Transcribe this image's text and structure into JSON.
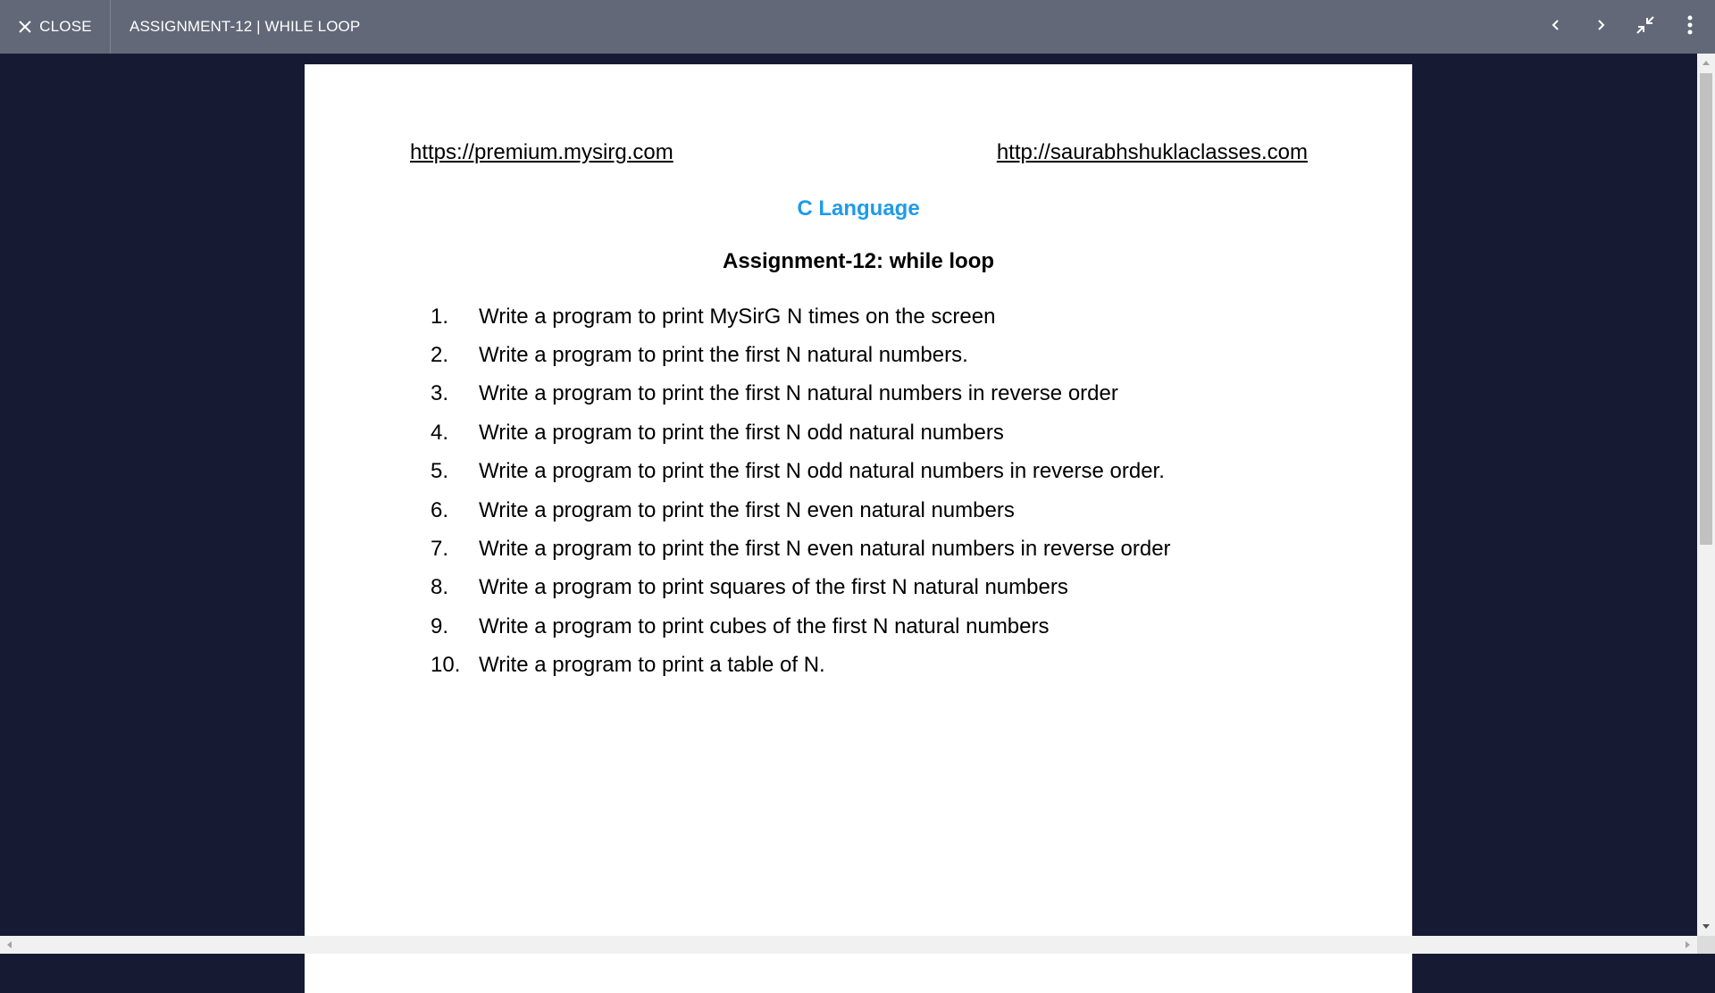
{
  "topbar": {
    "close_label": "CLOSE",
    "title": "ASSIGNMENT-12 | WHILE LOOP",
    "background": "#636878"
  },
  "icons": {
    "close": "close-icon",
    "prev": "chevron-left-icon",
    "next": "chevron-right-icon",
    "exit_fullscreen": "exit-fullscreen-icon",
    "more": "more-vertical-icon"
  },
  "document": {
    "link_left": "https://premium.mysirg.com",
    "link_right": "http://saurabhshuklaclasses.com",
    "subject": "C Language",
    "subject_color": "#1e9bea",
    "title": "Assignment-12: while loop",
    "questions": [
      {
        "num": "1.",
        "text": "Write a program to print MySirG N times on the screen"
      },
      {
        "num": "2.",
        "text": "Write a program to print the first N natural numbers."
      },
      {
        "num": "3.",
        "text": "Write a program to print the first N natural numbers in reverse order"
      },
      {
        "num": "4.",
        "text": "Write a program to print the first N odd natural numbers"
      },
      {
        "num": "5.",
        "text": "Write a program to print the first N odd natural numbers in reverse order."
      },
      {
        "num": "6.",
        "text": "Write a program to print the first N even natural numbers"
      },
      {
        "num": "7.",
        "text": "Write a program to print the first N even natural numbers in reverse order"
      },
      {
        "num": "8.",
        "text": "Write a program to print squares of the first N natural numbers"
      },
      {
        "num": "9.",
        "text": "Write a program to print cubes of the first N natural numbers"
      },
      {
        "num": "10.",
        "text": "Write a program to print a table of N."
      }
    ]
  },
  "colors": {
    "viewer_background": "#161b33",
    "page_background": "#ffffff"
  }
}
